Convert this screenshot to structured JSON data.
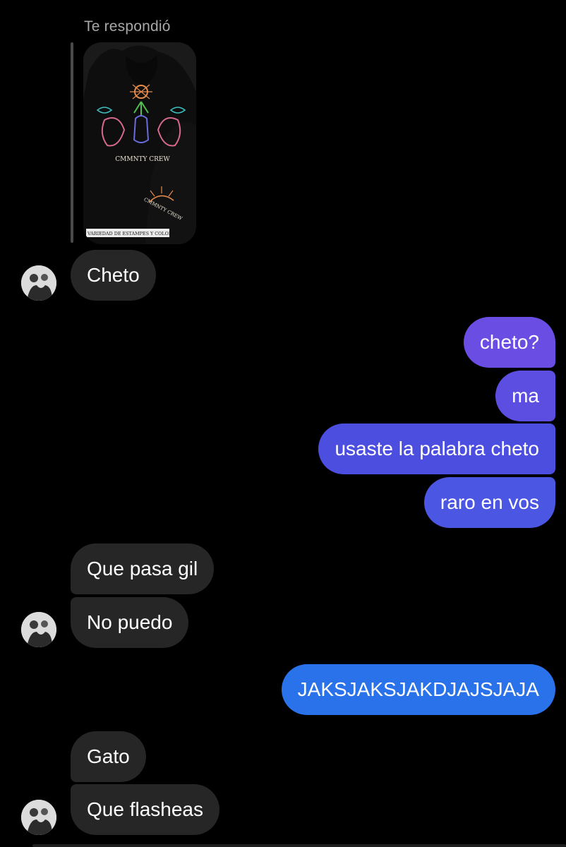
{
  "reply_label": "Te respondió",
  "story": {
    "shirt_text_1": "CMMNTY CREW",
    "shirt_text_2": "CMMNTY CREW",
    "caption": "VARIEDAD DE ESTAMPES Y COLORES"
  },
  "messages": [
    {
      "side": "in",
      "text": "Cheto"
    },
    {
      "side": "out",
      "text": "cheto?"
    },
    {
      "side": "out",
      "text": "ma"
    },
    {
      "side": "out",
      "text": "usaste la palabra cheto"
    },
    {
      "side": "out",
      "text": "raro en vos"
    },
    {
      "side": "in",
      "text": "Que pasa gil"
    },
    {
      "side": "in",
      "text": "No puedo"
    },
    {
      "side": "out",
      "text": "JAKSJAKSJAKDJAJSJAJA"
    },
    {
      "side": "in",
      "text": "Gato"
    },
    {
      "side": "in",
      "text": "Que flasheas"
    }
  ],
  "colors": {
    "background": "#000000",
    "incoming_bubble": "#262626",
    "outgoing_purple": "#6a4ee3",
    "outgoing_indigo": "#4c4ee0",
    "outgoing_blue": "#2a72ea"
  }
}
